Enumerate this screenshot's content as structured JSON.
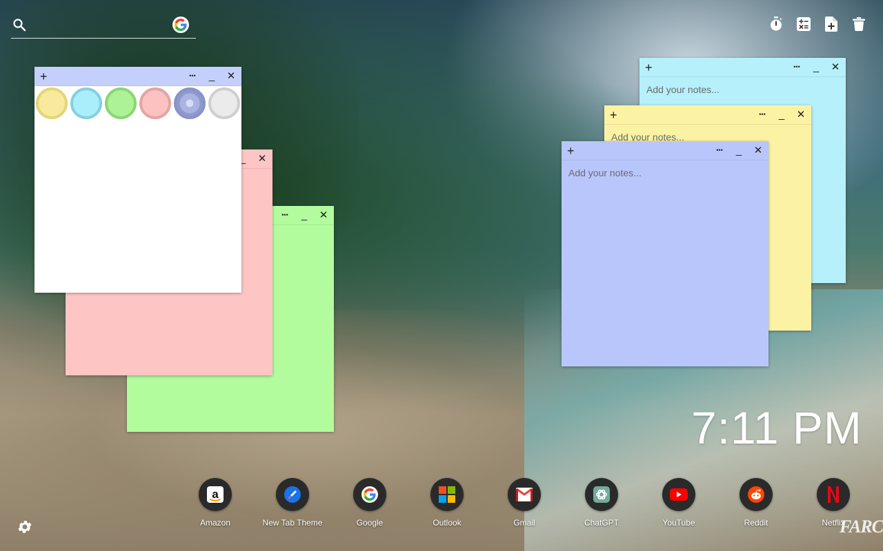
{
  "search": {
    "placeholder": "",
    "value": ""
  },
  "toolbar": {
    "items": [
      {
        "name": "timer",
        "icon": "stopwatch-icon"
      },
      {
        "name": "calculator",
        "icon": "calculator-icon"
      },
      {
        "name": "new-note",
        "icon": "add-file-icon"
      },
      {
        "name": "delete",
        "icon": "trash-icon"
      }
    ]
  },
  "notes": [
    {
      "id": "cyan",
      "color": "#b6f0fb",
      "placeholder": "Add your notes..."
    },
    {
      "id": "yellow",
      "color": "#fbf3a3",
      "placeholder": "Add your notes..."
    },
    {
      "id": "periwinkle",
      "color": "#b9c6fb",
      "placeholder": "Add your notes..."
    },
    {
      "id": "green",
      "color": "#b2fc9e",
      "placeholder": ""
    },
    {
      "id": "pink",
      "color": "#fec5c5",
      "placeholder": ""
    },
    {
      "id": "white",
      "color": "#ffffff",
      "header_color": "#c4d0fb",
      "placeholder": ""
    }
  ],
  "note_controls": {
    "add": "+",
    "more": "•••",
    "minimize": "_",
    "close": "✕"
  },
  "color_swatches": [
    {
      "name": "yellow",
      "fill": "#f7ea9c",
      "border": "#e2d579"
    },
    {
      "name": "cyan",
      "fill": "#aaeefb",
      "border": "#86cfdf"
    },
    {
      "name": "green",
      "fill": "#aef298",
      "border": "#8ad676"
    },
    {
      "name": "pink",
      "fill": "#fcc1c1",
      "border": "#e4a4a4"
    },
    {
      "name": "periwinkle",
      "fill": "#a9b4e6",
      "border": "#8894c8",
      "selected": true
    },
    {
      "name": "white",
      "fill": "#ebebeb",
      "border": "#cfcfcf"
    }
  ],
  "clock": {
    "time": "7:11 PM"
  },
  "shortcuts": [
    {
      "label": "Amazon",
      "icon": "amazon-icon"
    },
    {
      "label": "New Tab Theme",
      "icon": "brush-icon"
    },
    {
      "label": "Google",
      "icon": "google-icon"
    },
    {
      "label": "Outlook",
      "icon": "windows-icon"
    },
    {
      "label": "Gmail",
      "icon": "gmail-icon"
    },
    {
      "label": "ChatGPT",
      "icon": "chatgpt-icon"
    },
    {
      "label": "YouTube",
      "icon": "youtube-icon"
    },
    {
      "label": "Reddit",
      "icon": "reddit-icon"
    },
    {
      "label": "Netflix",
      "icon": "netflix-icon"
    }
  ],
  "logo": {
    "text": "FARC"
  }
}
